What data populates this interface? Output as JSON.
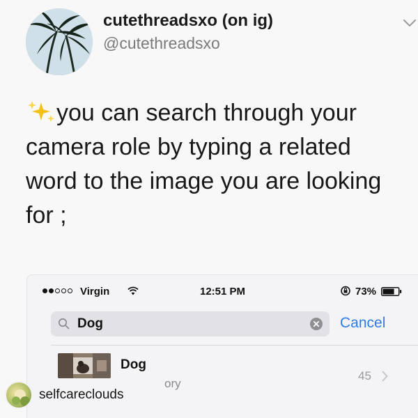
{
  "tweet": {
    "display_name": "cutethreadsxo (on ig)",
    "handle": "@cutethreadsxo",
    "text": "you can search through your\ncamera role by typing a related\nword to the image you are looking\nfor ;",
    "sparkle_icon": "sparkles-icon",
    "menu_icon": "chevron-down-icon"
  },
  "phone_screenshot": {
    "status_bar": {
      "signal": "●●ooo",
      "carrier": "Virgin",
      "time": "12:51 PM",
      "battery_percent": "73%",
      "battery_level": 0.73
    },
    "search": {
      "value": "Dog",
      "cancel_label": "Cancel"
    },
    "result": {
      "title": "Dog",
      "subtitle": "ory",
      "count": "45"
    },
    "colors": {
      "link": "#2d7be8"
    }
  },
  "repost": {
    "username": "selfcareclouds"
  }
}
